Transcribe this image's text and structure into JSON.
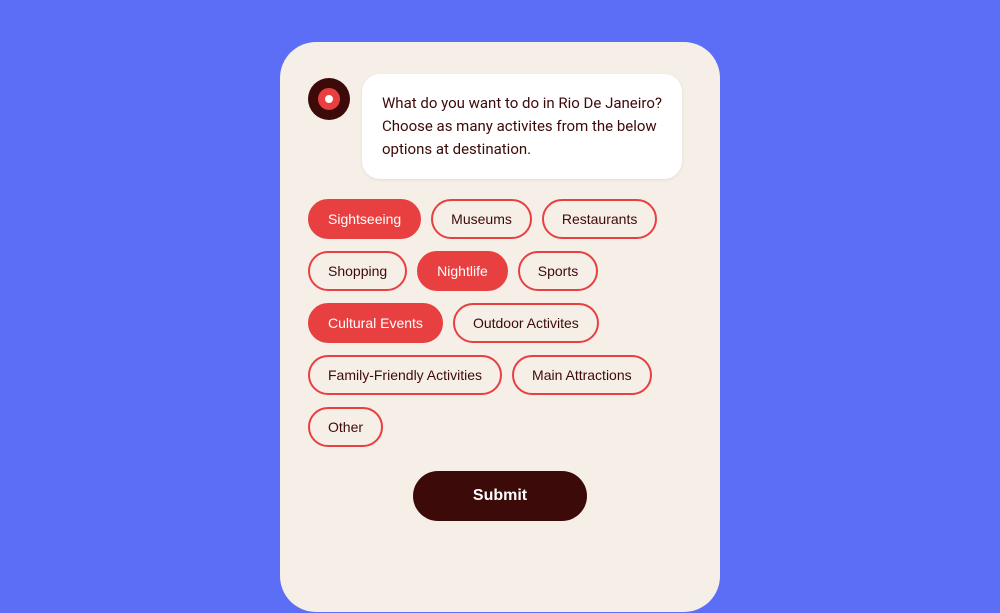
{
  "background_color": "#5B6EF5",
  "phone": {
    "background_color": "#F5EFE8"
  },
  "avatar": {
    "outer_color": "#3D0A0A",
    "inner_color": "#E84040"
  },
  "message": {
    "text": "What do you want to do in Rio De Janeiro? Choose as many activites from the below options at destination."
  },
  "options": [
    {
      "row": 1,
      "chips": [
        {
          "id": "sightseeing",
          "label": "Sightseeing",
          "selected": true
        },
        {
          "id": "museums",
          "label": "Museums",
          "selected": false
        },
        {
          "id": "restaurants",
          "label": "Restaurants",
          "selected": false
        }
      ]
    },
    {
      "row": 2,
      "chips": [
        {
          "id": "shopping",
          "label": "Shopping",
          "selected": false
        },
        {
          "id": "nightlife",
          "label": "Nightlife",
          "selected": true
        },
        {
          "id": "sports",
          "label": "Sports",
          "selected": false
        }
      ]
    },
    {
      "row": 3,
      "chips": [
        {
          "id": "cultural-events",
          "label": "Cultural Events",
          "selected": true
        },
        {
          "id": "outdoor-activites",
          "label": "Outdoor Activites",
          "selected": false
        }
      ]
    },
    {
      "row": 4,
      "chips": [
        {
          "id": "family-friendly",
          "label": "Family-Friendly Activities",
          "selected": false
        },
        {
          "id": "main-attractions",
          "label": "Main Attractions",
          "selected": false
        }
      ]
    },
    {
      "row": 5,
      "chips": [
        {
          "id": "other",
          "label": "Other",
          "selected": false
        }
      ]
    }
  ],
  "submit": {
    "label": "Submit"
  }
}
